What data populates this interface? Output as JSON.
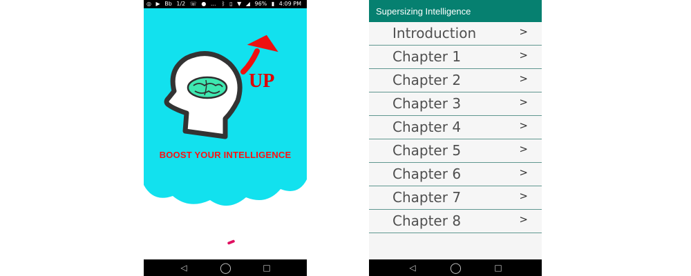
{
  "left_screen": {
    "status_bar": {
      "left_icons": [
        "camera-icon",
        "youtube-icon",
        "Bb",
        "1/2",
        "wifi-call-icon",
        "chat-icon",
        "..."
      ],
      "right_icons": [
        "bluetooth-icon",
        "vibrate-icon",
        "wifi-icon",
        "signal-icon"
      ],
      "battery": "96%",
      "time": "4:09 PM"
    },
    "splash": {
      "badge_text": "UP",
      "title": "BOOST YOUR INTELLIGENCE",
      "colors": {
        "background": "#12e1ee",
        "brain": "#3ee7b0",
        "accent": "#ff1010"
      }
    },
    "nav_bar": {
      "buttons": [
        "back-icon",
        "home-icon",
        "recents-icon"
      ]
    }
  },
  "right_screen": {
    "app_bar": {
      "title": "Supersizing Intelligence",
      "color": "#068070"
    },
    "chapters": [
      {
        "label": "Introduction",
        "arrow": ">"
      },
      {
        "label": "Chapter 1",
        "arrow": ">"
      },
      {
        "label": "Chapter 2",
        "arrow": ">"
      },
      {
        "label": "Chapter 3",
        "arrow": ">"
      },
      {
        "label": "Chapter 4",
        "arrow": ">"
      },
      {
        "label": "Chapter 5",
        "arrow": ">"
      },
      {
        "label": "Chapter 6",
        "arrow": ">"
      },
      {
        "label": "Chapter 7",
        "arrow": ">"
      },
      {
        "label": "Chapter 8",
        "arrow": ">"
      }
    ],
    "nav_bar": {
      "buttons": [
        "back-icon",
        "home-icon",
        "recents-icon"
      ]
    }
  }
}
